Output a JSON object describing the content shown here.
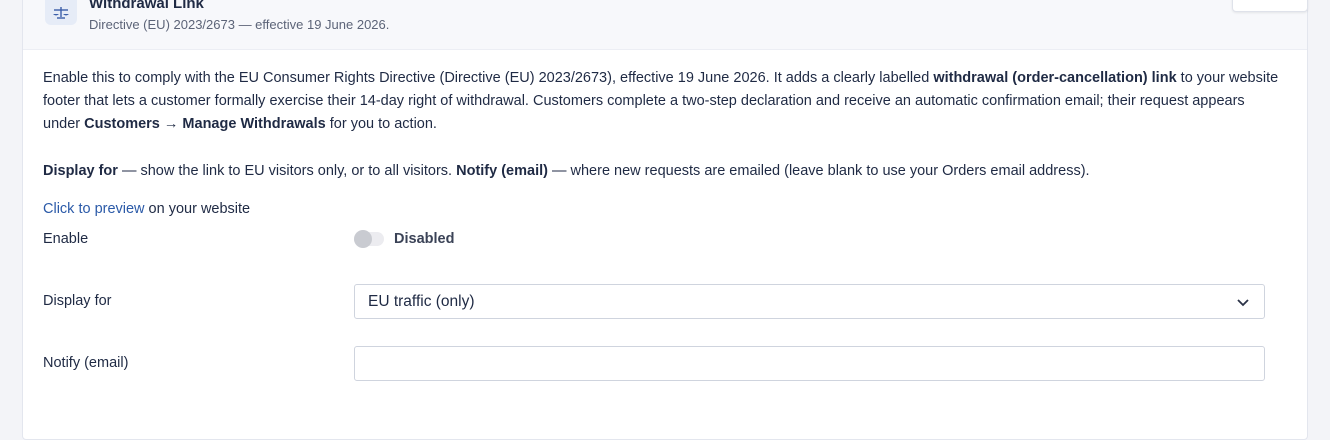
{
  "header": {
    "title": "Withdrawal Link",
    "subtitle": "Directive (EU) 2023/2673 — effective 19 June 2026.",
    "icon": "scales-icon"
  },
  "description": {
    "p1": "Enable this to comply with the EU Consumer Rights Directive (Directive (EU) 2023/2673), effective 19 June 2026. It adds a clearly labelled ",
    "bold1": "withdrawal (order-cancellation) link",
    "p2": " to your website footer that lets a customer formally exercise their 14-day right of withdrawal. Customers complete a two-step declaration and receive an automatic confirmation email; their request appears under ",
    "bold2": "Customers → Manage Withdrawals",
    "p3": " for you to action."
  },
  "note": {
    "bold1": "Display for",
    "t1": " — show the link to EU visitors only, or to all visitors. ",
    "bold2": "Notify (email)",
    "t2": " — where new requests are emailed (leave blank to use your Orders email address)."
  },
  "preview": {
    "link": "Click to preview",
    "suffix": " on your website"
  },
  "fields": {
    "enable_label": "Enable",
    "enable_state": "Disabled",
    "enable_on": false,
    "display_label": "Display for",
    "display_value": "EU traffic (only)",
    "notify_label": "Notify (email)",
    "notify_value": ""
  },
  "colors": {
    "link": "#2b5aa8",
    "text": "#1f2a44",
    "border": "#cfd4de"
  }
}
